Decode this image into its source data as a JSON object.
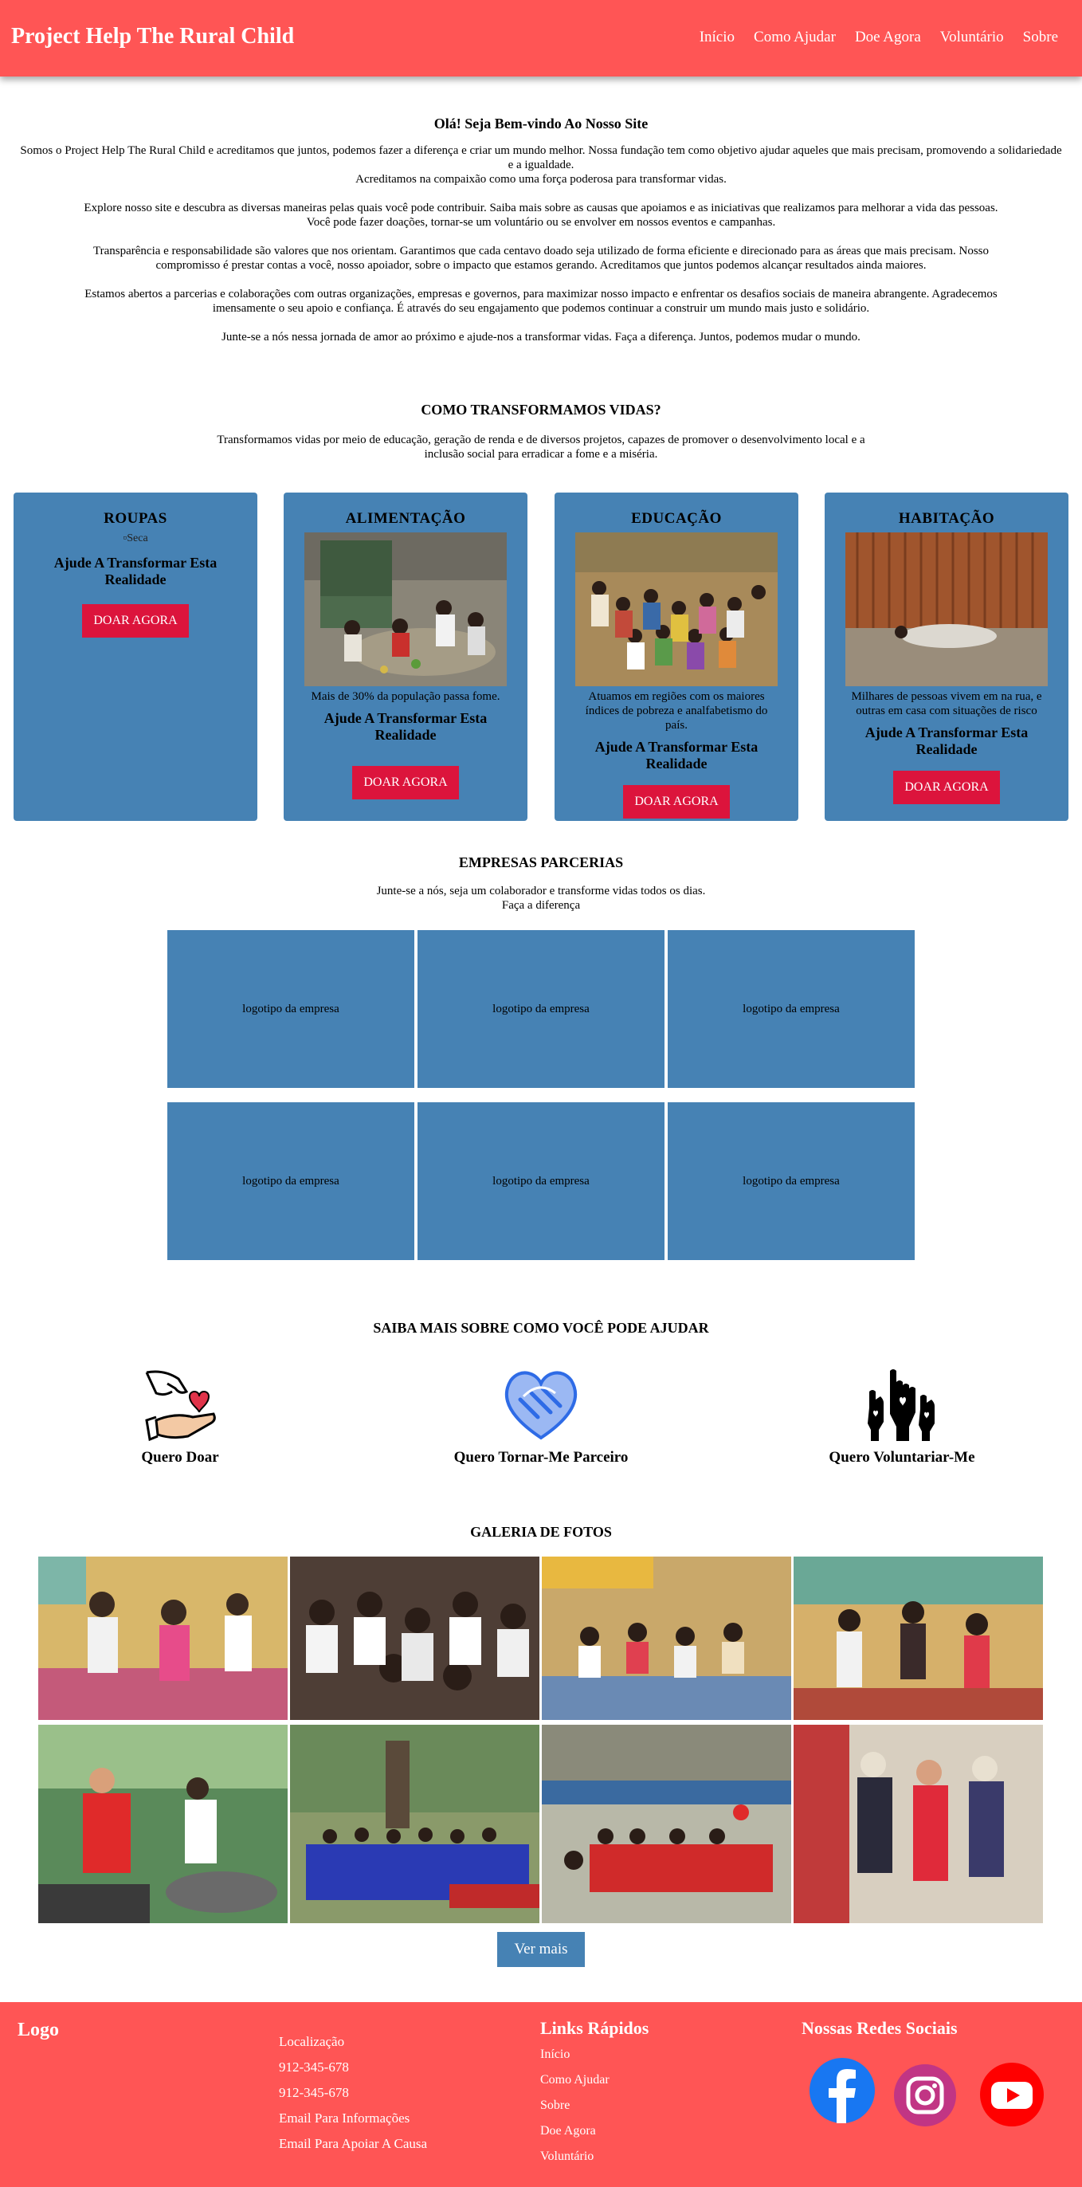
{
  "header": {
    "brand": "Project Help The Rural Child",
    "nav": [
      "Início",
      "Como Ajudar",
      "Doe Agora",
      "Voluntário",
      "Sobre"
    ]
  },
  "welcome": {
    "title": "Olá! Seja Bem-vindo Ao Nosso Site",
    "p1": "Somos o Project Help The Rural Child e acreditamos que juntos, podemos fazer a diferença e criar um mundo melhor. Nossa fundação tem como objetivo ajudar aqueles que mais precisam, promovendo a solidariedade e a igualdade.",
    "p1b": "Acreditamos na compaixão como uma força poderosa para transformar vidas.",
    "p2": "Explore nosso site e descubra as diversas maneiras pelas quais você pode contribuir. Saiba mais sobre as causas que apoiamos e as iniciativas que realizamos para melhorar a vida das pessoas. Você pode fazer doações, tornar-se um voluntário ou se envolver em nossos eventos e campanhas.",
    "p3": "Transparência e responsabilidade são valores que nos orientam. Garantimos que cada centavo doado seja utilizado de forma eficiente e direcionado para as áreas que mais precisam. Nosso compromisso é prestar contas a você, nosso apoiador, sobre o impacto que estamos gerando. Acreditamos que juntos podemos alcançar resultados ainda maiores.",
    "p4": "Estamos abertos a parcerias e colaborações com outras organizações, empresas e governos, para maximizar nosso impacto e enfrentar os desafios sociais de maneira abrangente. Agradecemos imensamente o seu apoio e confiança. É através do seu engajamento que podemos continuar a construir um mundo mais justo e solidário.",
    "p5": "Junte-se a nós nessa jornada de amor ao próximo e ajude-nos a transformar vidas. Faça a diferença. Juntos, podemos mudar o mundo."
  },
  "how": {
    "title": "COMO TRANSFORMAMOS VIDAS?",
    "text": "Transformamos vidas por meio de educação, geração de renda e de diversos projetos, capazes de promover o desenvolvimento local e a inclusão social para erradicar a fome e a miséria."
  },
  "cards": [
    {
      "title": "ROUPAS",
      "img_alt": "Seca",
      "caption": "",
      "help": "Ajude A Transformar Esta Realidade",
      "button": "DOAR AGORA"
    },
    {
      "title": "ALIMENTAÇÃO",
      "caption": "Mais de 30% da população passa fome.",
      "help": "Ajude A Transformar Esta Realidade",
      "button": "DOAR AGORA"
    },
    {
      "title": "EDUCAÇÃO",
      "caption": "Atuamos em regiões com os maiores índices de pobreza e analfabetismo do país.",
      "help": "Ajude A Transformar Esta Realidade",
      "button": "DOAR AGORA"
    },
    {
      "title": "HABITAÇÃO",
      "caption": "Milhares de pessoas vivem em na rua, e outras em casa com situações de risco",
      "help": "Ajude A Transformar Esta Realidade",
      "button": "DOAR AGORA"
    }
  ],
  "partners": {
    "title": "EMPRESAS PARCERIAS",
    "line1": "Junte-se a nós, seja um colaborador e transforme vidas todos os dias.",
    "line2": "Faça a diferença",
    "logos": [
      "logotipo da empresa",
      "logotipo da empresa",
      "logotipo da empresa",
      "logotipo da empresa",
      "logotipo da empresa",
      "logotipo da empresa"
    ]
  },
  "help": {
    "title": "SAIBA MAIS SOBRE COMO VOCÊ PODE AJUDAR",
    "items": [
      {
        "label": "Quero Doar",
        "icon": "donate-hand-heart-icon"
      },
      {
        "label": "Quero Tornar-Me Parceiro",
        "icon": "handshake-heart-icon"
      },
      {
        "label": "Quero Voluntariar-Me",
        "icon": "raised-hands-hearts-icon"
      }
    ]
  },
  "gallery": {
    "title": "GALERIA DE FOTOS",
    "more": "Ver mais"
  },
  "footer": {
    "logo": "Logo",
    "contacts": [
      "Localização",
      "912-345-678",
      "912-345-678",
      "Email Para Informações",
      "Email Para Apoiar A Causa"
    ],
    "links_title": "Links Rápidos",
    "links": [
      "Início",
      "Como Ajudar",
      "Sobre",
      "Doe Agora",
      "Voluntário"
    ],
    "social_title": "Nossas Redes Sociais",
    "social": [
      "facebook-icon",
      "instagram-icon",
      "youtube-icon"
    ]
  },
  "colors": {
    "header": "#ff5555",
    "card": "#4682b4",
    "button": "#dc143c"
  }
}
